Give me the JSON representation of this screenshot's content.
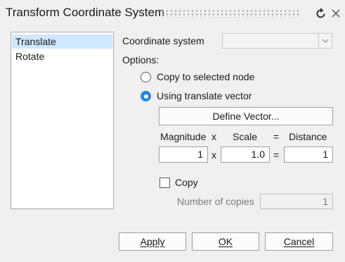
{
  "window": {
    "title": "Transform Coordinate System"
  },
  "icons": {
    "reset": "refresh-icon",
    "close": "close-icon",
    "dropdown": "chevron-down-icon"
  },
  "list": {
    "items": [
      {
        "label": "Translate",
        "selected": true
      },
      {
        "label": "Rotate",
        "selected": false
      }
    ]
  },
  "form": {
    "coordinate_system_label": "Coordinate system",
    "coordinate_system_value": "",
    "options_label": "Options:",
    "radio_copy_to_node": "Copy to selected node",
    "radio_translate_vector": "Using translate vector",
    "selected_option": "Using translate vector",
    "define_vector_button": "Define Vector...",
    "headers": {
      "magnitude": "Magnitude",
      "times": "x",
      "scale": "Scale",
      "equals": "=",
      "distance": "Distance"
    },
    "values": {
      "magnitude": "1",
      "times": "x",
      "scale": "1.0",
      "equals": "=",
      "distance": "1"
    },
    "copy_label": "Copy",
    "copy_checked": false,
    "number_of_copies_label": "Number of copies",
    "number_of_copies_value": "1"
  },
  "buttons": {
    "apply": "Apply",
    "ok": "OK",
    "cancel": "Cancel"
  },
  "colors": {
    "accent": "#1e88e5",
    "selection": "#cde8ff"
  }
}
